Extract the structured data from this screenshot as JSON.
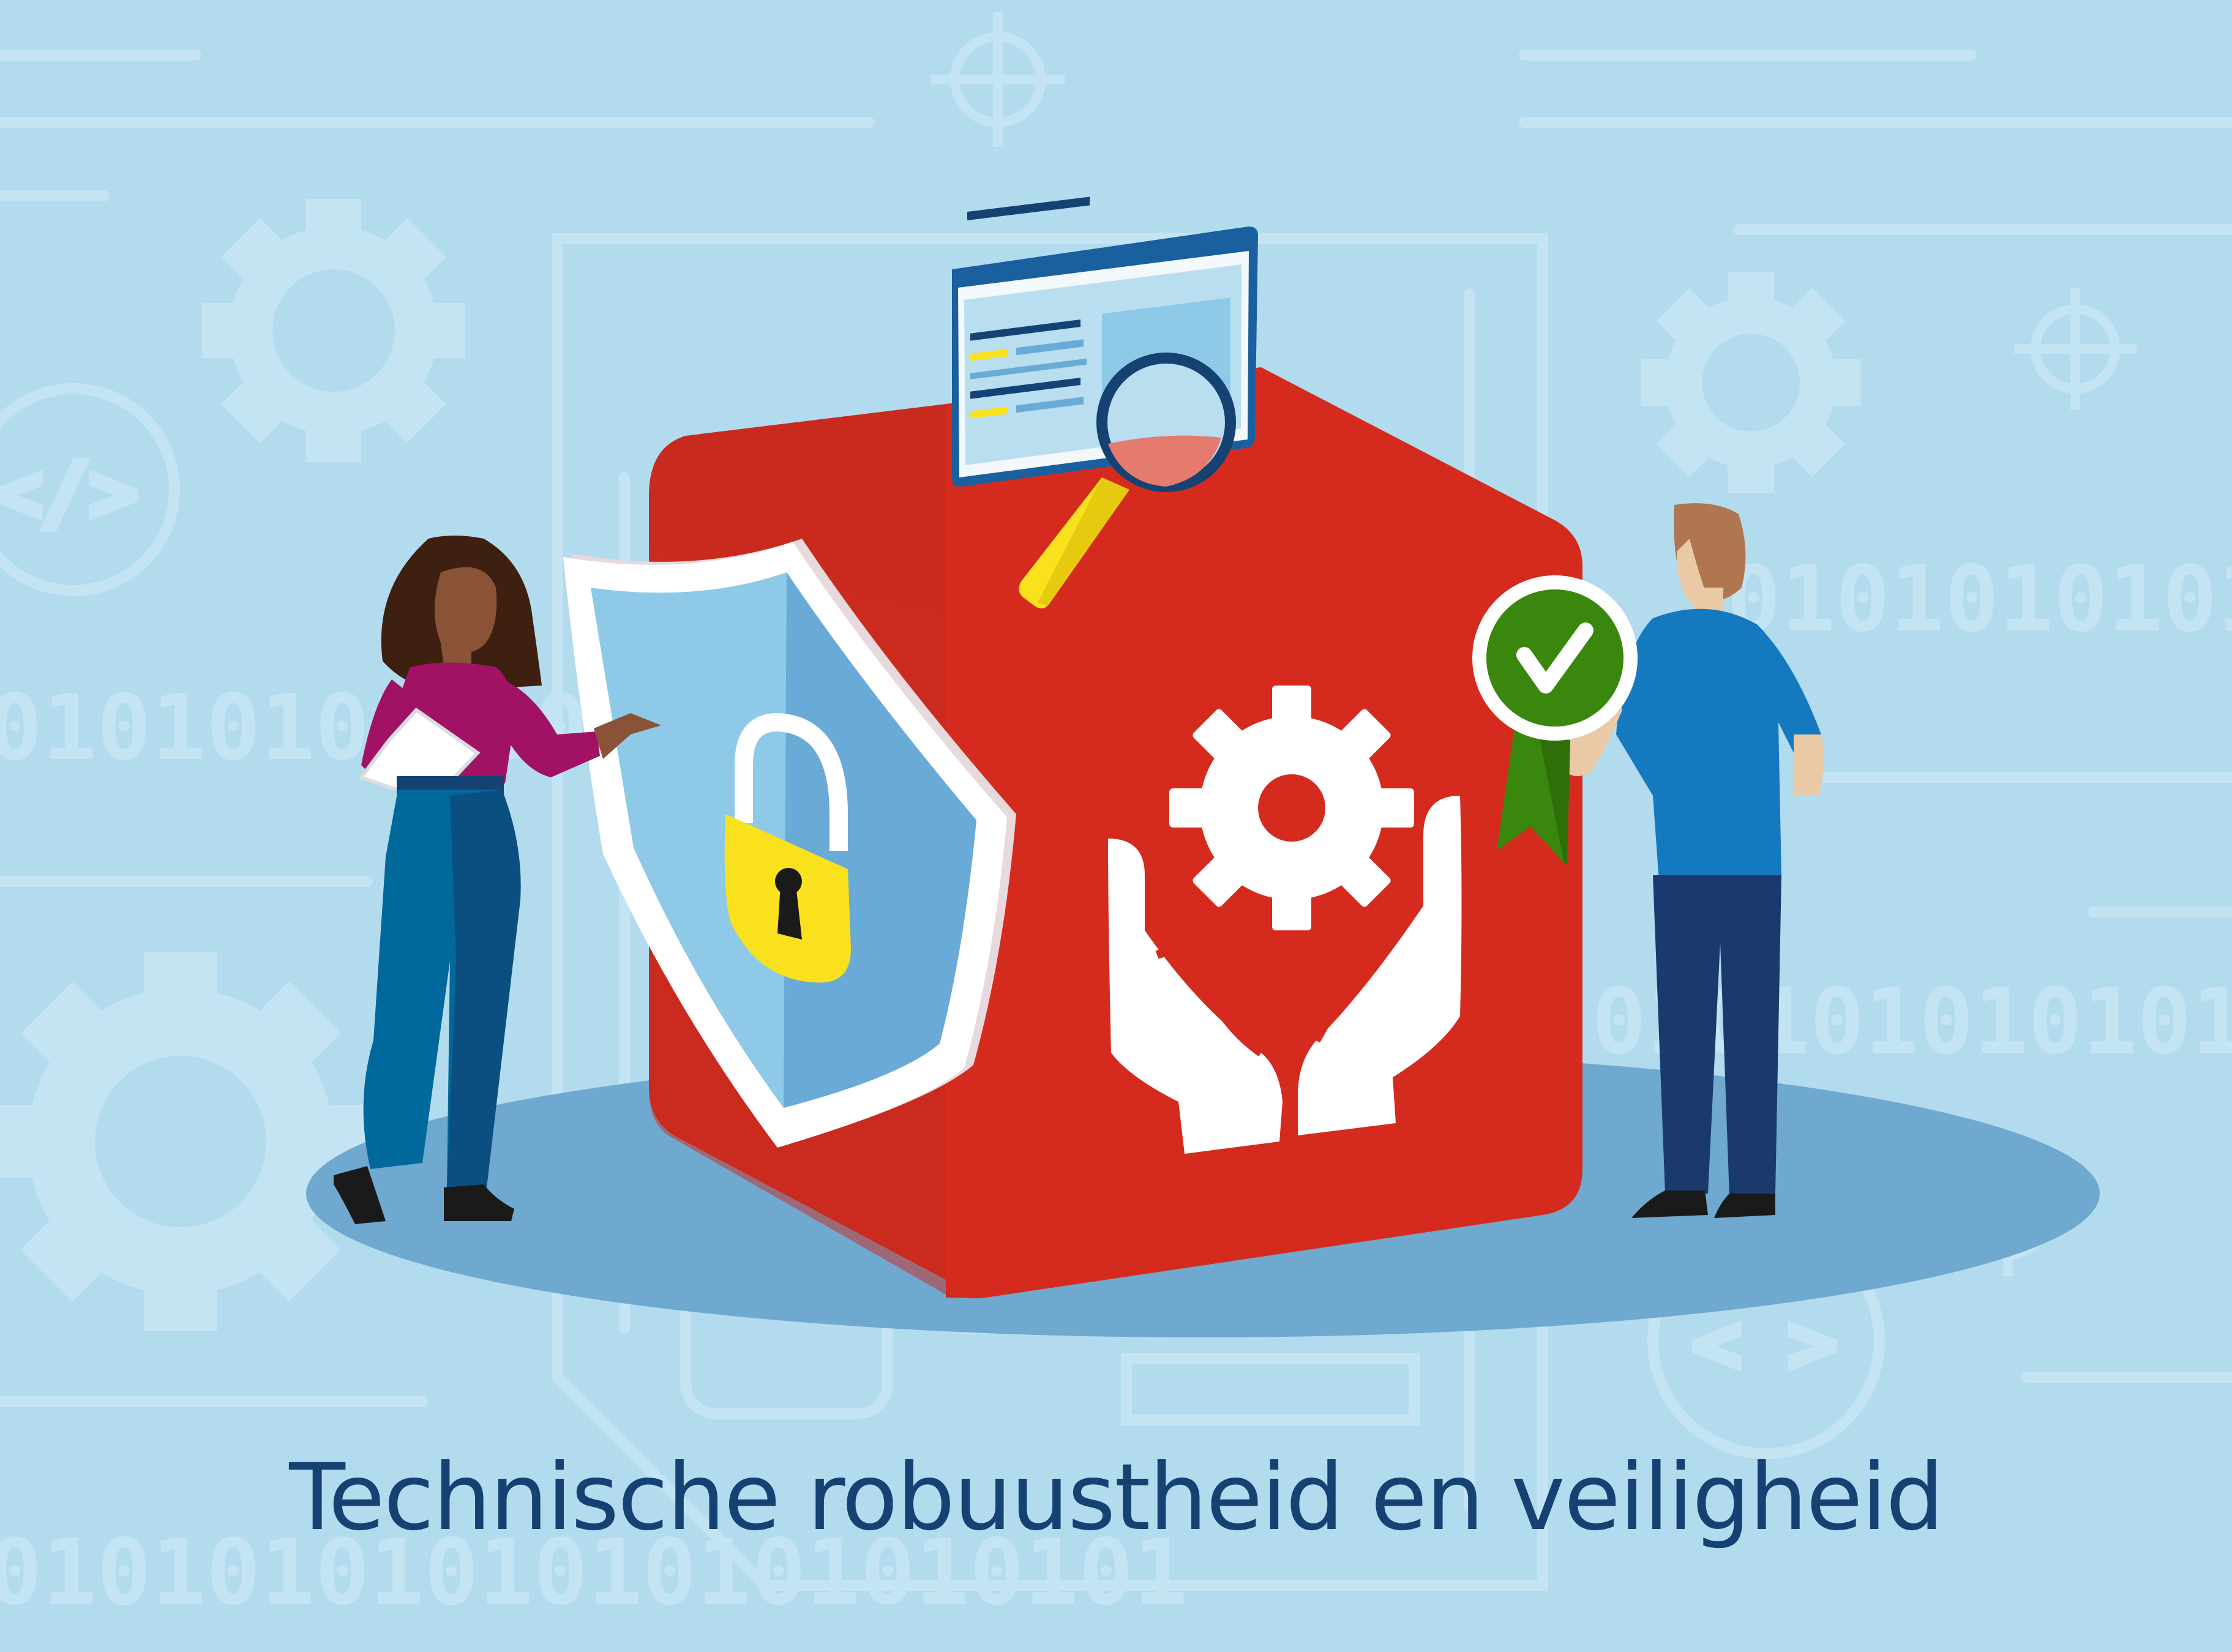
{
  "title": "Technische robuustheid en veiligheid",
  "background": {
    "binary_text": "0101010101010101010101",
    "code_symbol_1": "</>",
    "code_symbol_2": "< >"
  },
  "colors": {
    "background": "#b3dbee",
    "background_pattern": "#c4e4f3",
    "house_red": "#d52b1e",
    "shield_blue": "#8ecae8",
    "lock_yellow": "#f9e11e",
    "badge_green": "#39870c",
    "caption_blue": "#154273",
    "platform_blue": "#6fa9cf"
  },
  "icons": [
    "shield-icon",
    "padlock-icon",
    "gear-icon",
    "caring-hands-icon",
    "browser-window-icon",
    "magnifier-icon",
    "checkmark-badge-icon"
  ]
}
